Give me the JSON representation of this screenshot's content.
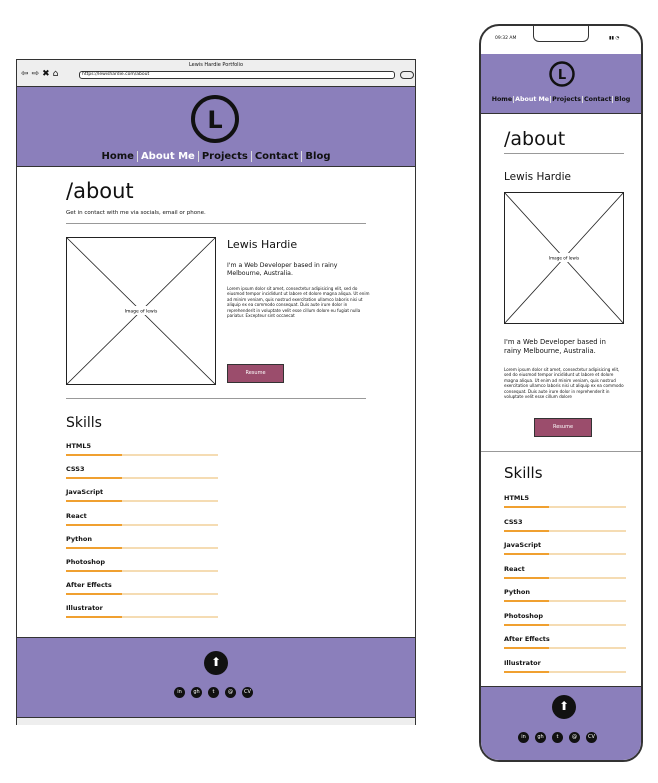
{
  "desktop": {
    "window_title": "Lewis Hardie Portfolio",
    "url": "https://lewishardie.com/about",
    "nav_icons": [
      "back-icon",
      "forward-icon",
      "close-icon",
      "home-icon"
    ],
    "logo_letter": "L",
    "nav": [
      "Home",
      "About Me",
      "Projects",
      "Contact",
      "Blog"
    ],
    "active_nav": "About Me",
    "page_title": "/about",
    "subtitle": "Get in contact with me via socials, email or phone.",
    "image_label": "Image of lewis",
    "name": "Lewis Hardie",
    "intro": "I'm a Web Developer based in rainy Melbourne, Australia.",
    "lorem": "Lorem ipsum dolor sit amet, consectetur adipisicing elit, sed do eiusmod tempor incididunt ut labore et dolore magna aliqua. Ut enim ad minim veniam, quis nostrud exercitation ullamco laboris nisi ut aliquip ex ea commodo consequat. Duis aute irure dolor in reprehenderit in voluptate velit esse cillum dolore eu fugiat nulla pariatur. Excepteur sint occaecat",
    "resume_label": "Resume",
    "skills_title": "Skills",
    "skills": [
      {
        "name": "HTML5",
        "level": 0.37
      },
      {
        "name": "CSS3",
        "level": 0.37
      },
      {
        "name": "JavaScript",
        "level": 0.37
      },
      {
        "name": "React",
        "level": 0.37
      },
      {
        "name": "Python",
        "level": 0.37
      },
      {
        "name": "Photoshop",
        "level": 0.37
      },
      {
        "name": "After Effects",
        "level": 0.37
      },
      {
        "name": "Illustrator",
        "level": 0.37
      }
    ],
    "footer_up_icon": "arrow-up-icon",
    "socials": [
      {
        "icon": "linkedin-icon",
        "glyph": "in"
      },
      {
        "icon": "github-icon",
        "glyph": "gh"
      },
      {
        "icon": "twitter-icon",
        "glyph": "t"
      },
      {
        "icon": "email-icon",
        "glyph": "@"
      },
      {
        "icon": "cv-icon",
        "glyph": "CV"
      }
    ]
  },
  "mobile": {
    "status_time": "09:32 AM",
    "logo_letter": "L",
    "nav": [
      "Home",
      "About Me",
      "Projects",
      "Contact",
      "Blog"
    ],
    "active_nav": "About Me",
    "page_title": "/about",
    "name": "Lewis Hardie",
    "image_label": "Image of lewis",
    "intro": "I'm a Web Developer based in rainy Melbourne, Australia.",
    "lorem": "Lorem ipsum dolor sit amet, consectetur adipisicing elit, sed do eiusmod tempor incididunt ut labore et dolore magna aliqua. Ut enim ad minim veniam, quis nostrud exercitation ullamco laboris nisi ut aliquip ex ea commodo consequat. Duis aute irure dolor in reprehenderit in voluptate velit esse cillum dolore",
    "resume_label": "Resume",
    "skills_title": "Skills",
    "skills": [
      {
        "name": "HTML5",
        "level": 0.37
      },
      {
        "name": "CSS3",
        "level": 0.37
      },
      {
        "name": "JavaScript",
        "level": 0.37
      },
      {
        "name": "React",
        "level": 0.37
      },
      {
        "name": "Python",
        "level": 0.37
      },
      {
        "name": "Photoshop",
        "level": 0.37
      },
      {
        "name": "After Effects",
        "level": 0.37
      },
      {
        "name": "Illustrator",
        "level": 0.37
      }
    ]
  },
  "colors": {
    "header_purple": "#8b7fbb",
    "resume_button": "#9b4d6c",
    "skill_bar_fill": "#f0a030",
    "skill_bar_track": "#f5dcb3"
  }
}
